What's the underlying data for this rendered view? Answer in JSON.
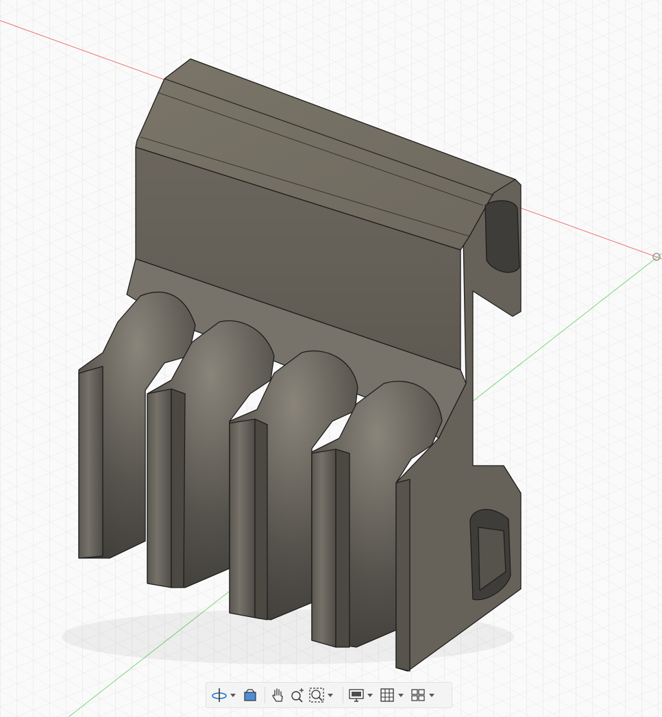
{
  "app": {
    "window_title": ""
  },
  "viewport": {
    "background": "#fafafa",
    "grid_color": "#e3e3e3",
    "x_axis_color": "#f06a6a",
    "y_axis_color": "#7ad67a",
    "model_color": "#6f6a62"
  },
  "navigation_toolbar": {
    "items": [
      {
        "name": "orbit",
        "icon": "orbit-icon",
        "has_dropdown": true
      },
      {
        "name": "look-at",
        "icon": "look-at-icon",
        "has_dropdown": false
      },
      {
        "name": "pan",
        "icon": "pan-hand-icon",
        "has_dropdown": false
      },
      {
        "name": "zoom",
        "icon": "zoom-icon",
        "has_dropdown": false
      },
      {
        "name": "fit",
        "icon": "fit-window-icon",
        "has_dropdown": true
      },
      {
        "name": "display-settings",
        "icon": "display-settings-icon",
        "has_dropdown": true
      },
      {
        "name": "grid-and-snaps",
        "icon": "grid-icon",
        "has_dropdown": true
      },
      {
        "name": "viewports",
        "icon": "viewports-icon",
        "has_dropdown": true
      }
    ]
  }
}
